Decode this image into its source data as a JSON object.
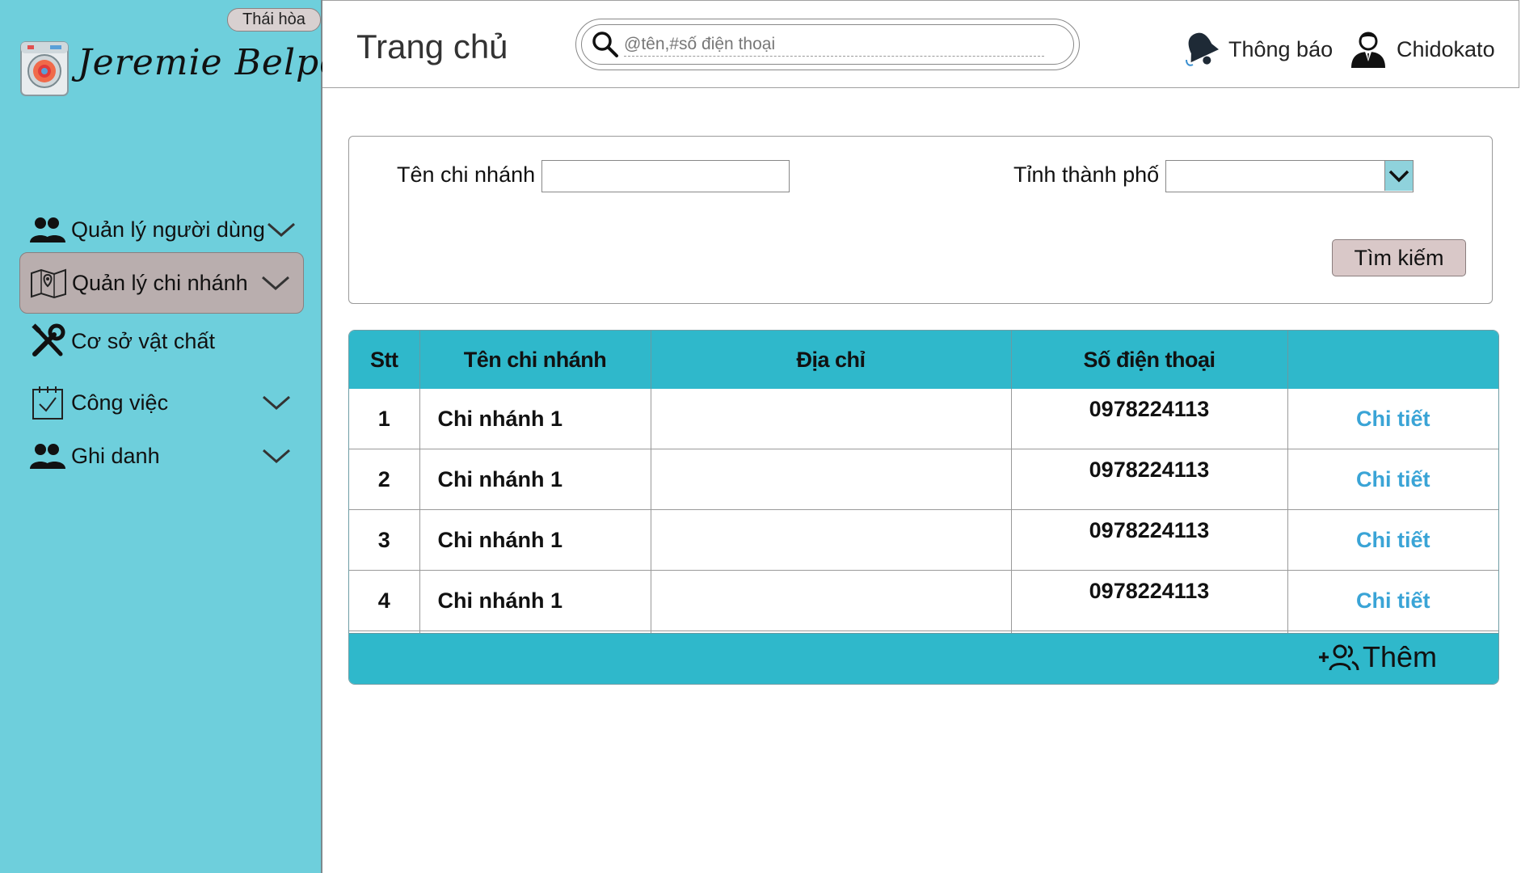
{
  "sidebar": {
    "branch_tag": "Thái hòa",
    "brand": "Jeremie Belpois",
    "items": [
      {
        "label": "Quản lý người dùng",
        "icon": "users-icon",
        "active": false,
        "expandable": true
      },
      {
        "label": "Quản lý chi nhánh",
        "icon": "map-icon",
        "active": true,
        "expandable": true
      },
      {
        "label": "Cơ sở vật chất",
        "icon": "tools-icon",
        "active": false,
        "expandable": false
      },
      {
        "label": "Công việc",
        "icon": "calendar-check-icon",
        "active": false,
        "expandable": true
      },
      {
        "label": "Ghi danh",
        "icon": "users-icon",
        "active": false,
        "expandable": true
      }
    ]
  },
  "header": {
    "title": "Trang chủ",
    "search_placeholder": "@tên,#số điện thoại",
    "notification_label": "Thông báo",
    "user_name": "Chidokato"
  },
  "filter": {
    "branch_name_label": "Tên chi nhánh",
    "branch_name_value": "",
    "city_label": "Tỉnh thành phố",
    "city_value": "",
    "search_button": "Tìm kiếm"
  },
  "table": {
    "columns": [
      "Stt",
      "Tên chi nhánh",
      "Địa chỉ",
      "Số điện thoại",
      ""
    ],
    "rows": [
      {
        "stt": "1",
        "name": "Chi nhánh 1",
        "address": "",
        "phone": "0978224113",
        "action": "Chi tiết"
      },
      {
        "stt": "2",
        "name": "Chi nhánh 1",
        "address": "",
        "phone": "0978224113",
        "action": "Chi tiết"
      },
      {
        "stt": "3",
        "name": "Chi nhánh 1",
        "address": "",
        "phone": "0978224113",
        "action": "Chi tiết"
      },
      {
        "stt": "4",
        "name": "Chi nhánh 1",
        "address": "",
        "phone": "0978224113",
        "action": "Chi tiết"
      }
    ],
    "add_button": "Thêm"
  },
  "colors": {
    "sidebar_bg": "#6ecfdc",
    "active_item_bg": "#b9aeae",
    "table_header_bg": "#2fb8cb",
    "link": "#3aa4d6",
    "search_button_bg": "#d9c8c8"
  }
}
